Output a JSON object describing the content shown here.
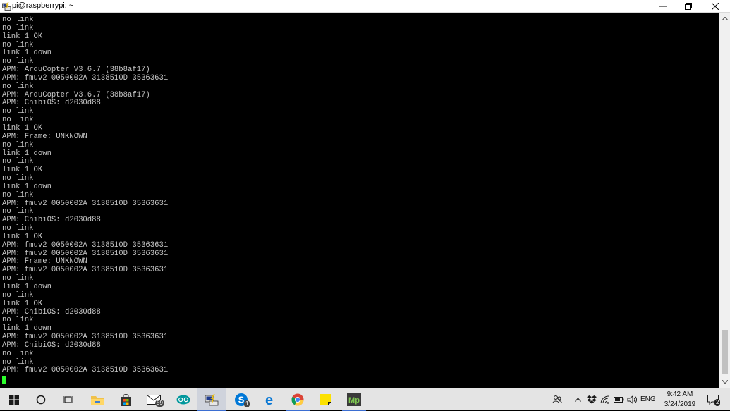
{
  "window": {
    "title": "pi@raspberrypi: ~",
    "minimize_label": "—",
    "restore_label": "❐",
    "close_label": "✕"
  },
  "terminal": {
    "lines": [
      "no link",
      "no link",
      "link 1 OK",
      "no link",
      "link 1 down",
      "no link",
      "APM: ArduCopter V3.6.7 (38b8af17)",
      "APM: fmuv2 0050002A 3138510D 35363631",
      "no link",
      "APM: ArduCopter V3.6.7 (38b8af17)",
      "APM: ChibiOS: d2030d88",
      "no link",
      "no link",
      "link 1 OK",
      "APM: Frame: UNKNOWN",
      "no link",
      "link 1 down",
      "no link",
      "link 1 OK",
      "no link",
      "link 1 down",
      "no link",
      "APM: fmuv2 0050002A 3138510D 35363631",
      "no link",
      "APM: ChibiOS: d2030d88",
      "no link",
      "link 1 OK",
      "APM: fmuv2 0050002A 3138510D 35363631",
      "APM: fmuv2 0050002A 3138510D 35363631",
      "APM: Frame: UNKNOWN",
      "APM: fmuv2 0050002A 3138510D 35363631",
      "no link",
      "link 1 down",
      "no link",
      "link 1 OK",
      "APM: ChibiOS: d2030d88",
      "no link",
      "link 1 down",
      "APM: fmuv2 0050002A 3138510D 35363631",
      "APM: ChibiOS: d2030d88",
      "no link",
      "no link",
      "APM: fmuv2 0050002A 3138510D 35363631"
    ],
    "cursor_color": "#2bff2b",
    "text_color": "#c7c7c7"
  },
  "taskbar": {
    "apps": [
      {
        "name": "start-button",
        "icon": "windows-logo-icon"
      },
      {
        "name": "cortana-search-button",
        "icon": "circle-icon"
      },
      {
        "name": "task-view-button",
        "icon": "task-view-icon"
      },
      {
        "name": "file-explorer-button",
        "icon": "folder-icon"
      },
      {
        "name": "store-button",
        "icon": "store-bag-icon"
      },
      {
        "name": "mail-button",
        "icon": "mail-icon"
      },
      {
        "name": "arduino-button",
        "icon": "arduino-icon"
      },
      {
        "name": "putty-button",
        "icon": "putty-icon"
      },
      {
        "name": "skype-button",
        "icon": "skype-icon"
      },
      {
        "name": "edge-button",
        "icon": "edge-icon"
      },
      {
        "name": "chrome-button",
        "icon": "chrome-icon"
      },
      {
        "name": "sticky-notes-button",
        "icon": "sticky-notes-icon"
      },
      {
        "name": "mission-planner-button",
        "icon": "mission-planner-icon"
      }
    ],
    "mail_badge": "59",
    "skype_badge": "1",
    "mp_label": "Mp",
    "language": "ENG",
    "time": "9:42 AM",
    "date": "3/24/2019",
    "notification_count": "2"
  }
}
